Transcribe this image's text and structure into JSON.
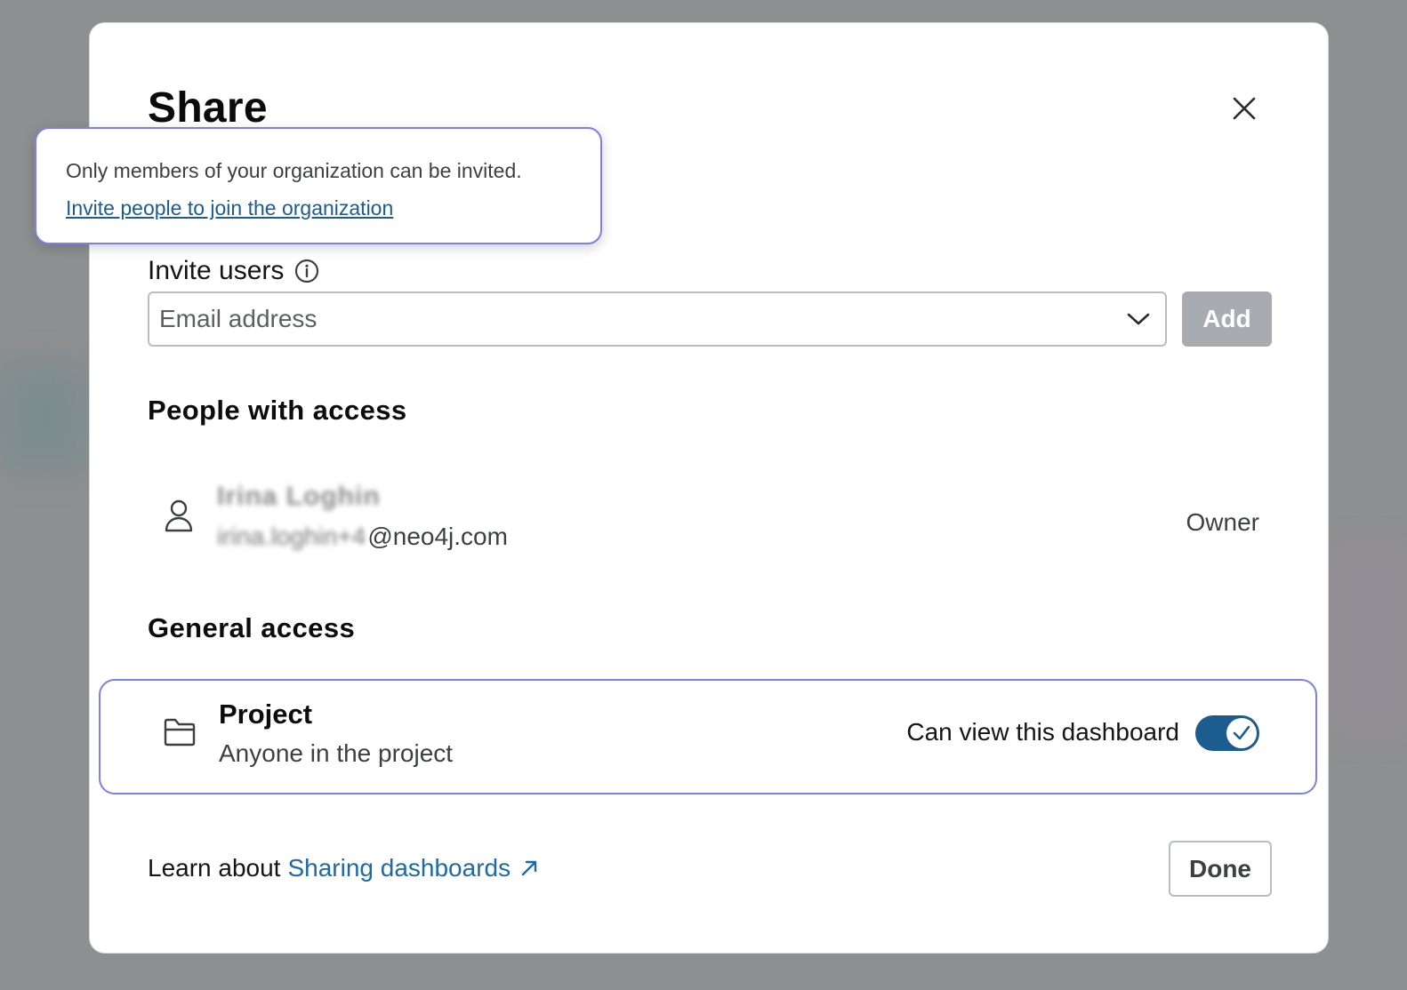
{
  "colors": {
    "accent_outline": "#7b7ff0",
    "toggle_on": "#1d5c8f",
    "link": "#1d6aa8",
    "add_button_disabled": "#a8acb1"
  },
  "modal": {
    "title": "Share",
    "close_icon": "close-icon"
  },
  "tooltip": {
    "message": "Only members of your organization can be invited.",
    "link_label": "Invite people to join the organization"
  },
  "invite": {
    "label": "Invite users",
    "info_icon": "info-icon",
    "email_placeholder": "Email address",
    "email_value": "",
    "dropdown_icon": "chevron-down-icon",
    "add_label": "Add"
  },
  "people_with_access": {
    "heading": "People with access",
    "people": [
      {
        "name": "Irina Loghin",
        "email_prefix": "irina.loghin+4",
        "email_domain": "@neo4j.com",
        "role": "Owner",
        "icon": "person-icon"
      }
    ]
  },
  "general_access": {
    "heading": "General access",
    "option_title": "Project",
    "option_subtitle": "Anyone in the project",
    "icon": "folder-icon",
    "permission_label": "Can view this dashboard",
    "toggle_on": true
  },
  "footer": {
    "learn_prefix": "Learn about",
    "learn_link": "Sharing dashboards",
    "link_icon": "external-link-icon",
    "done_label": "Done"
  }
}
